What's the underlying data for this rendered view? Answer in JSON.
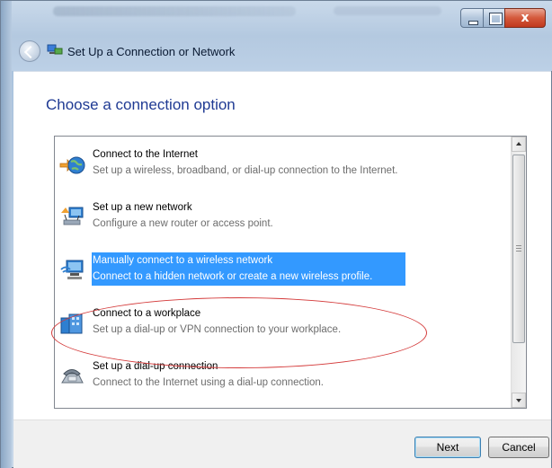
{
  "window": {
    "title": "Set Up a Connection or Network",
    "back_icon": "back-arrow-icon",
    "caption_buttons": [
      "minimize",
      "maximize",
      "close"
    ],
    "close_glyph": "x"
  },
  "page": {
    "heading": "Choose a connection option"
  },
  "options": [
    {
      "icon": "internet-globe-icon",
      "title": "Connect to the Internet",
      "description": "Set up a wireless, broadband, or dial-up connection to the Internet.",
      "selected": false
    },
    {
      "icon": "new-network-icon",
      "title": "Set up a new network",
      "description": "Configure a new router or access point.",
      "selected": false
    },
    {
      "icon": "wireless-network-icon",
      "title": "Manually connect to a wireless network",
      "description": "Connect to a hidden network or create a new wireless profile.",
      "selected": true
    },
    {
      "icon": "workplace-icon",
      "title": "Connect to a workplace",
      "description": "Set up a dial-up or VPN connection to your workplace.",
      "selected": false
    },
    {
      "icon": "dialup-phone-icon",
      "title": "Set up a dial-up connection",
      "description": "Connect to the Internet using a dial-up connection.",
      "selected": false
    }
  ],
  "footer": {
    "next_label": "Next",
    "cancel_label": "Cancel"
  },
  "colors": {
    "selection": "#3399ff",
    "heading": "#1f3a93",
    "annotation": "#d43a3a"
  }
}
